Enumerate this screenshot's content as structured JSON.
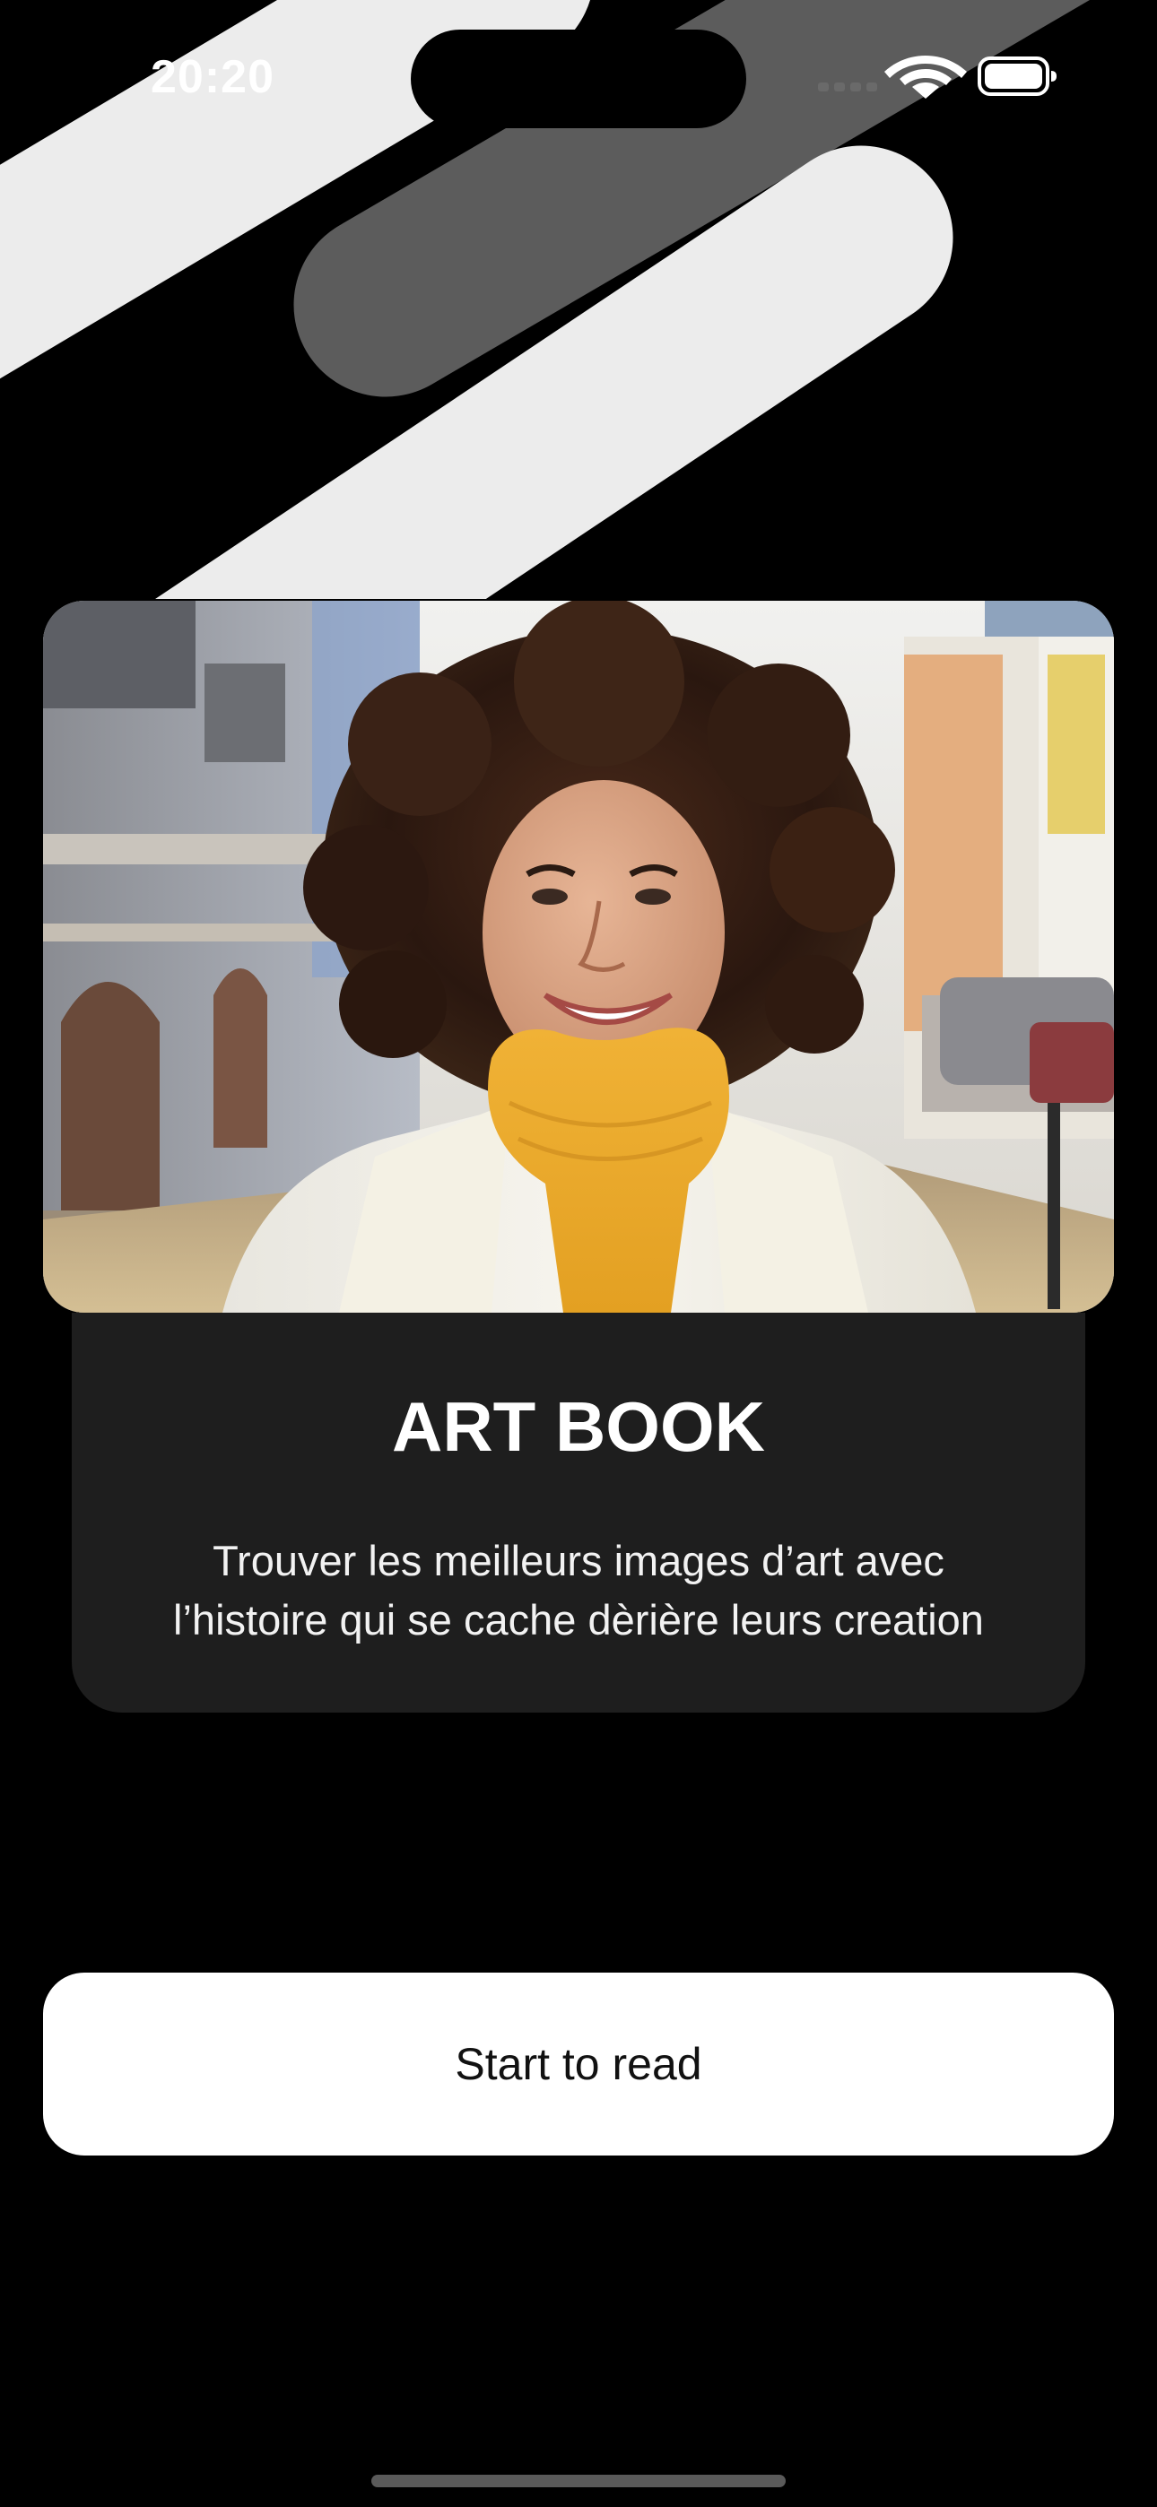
{
  "status_bar": {
    "time": "20:20"
  },
  "card": {
    "title": "ART BOOK",
    "description_line1": "Trouver les meilleurs images d’art avec",
    "description_line2": "l’histoire qui se cache dèrière leurs creation"
  },
  "actions": {
    "start_label": "Start to read"
  },
  "colors": {
    "background": "#000000",
    "card_background": "#1e1e1e",
    "button_background": "#ffffff",
    "decor_light": "#ececec",
    "decor_dark": "#5c5c5c"
  },
  "icons": {
    "signal": "cellular-signal-icon",
    "wifi": "wifi-icon",
    "battery": "battery-icon"
  }
}
